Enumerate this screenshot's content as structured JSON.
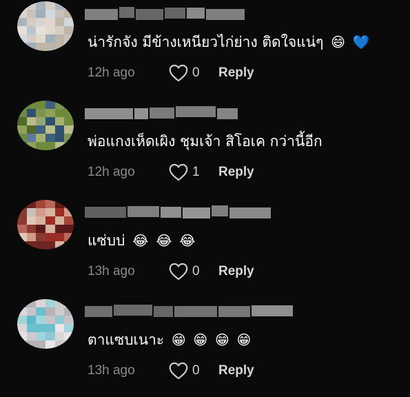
{
  "comments": [
    {
      "text": "น่ารักจัง มีข้างเหนียวไก่ย่าง ติดใจแน่ๆ",
      "emojis": [
        "😄",
        "💙"
      ],
      "time": "12h ago",
      "likes": "0",
      "reply_label": "Reply"
    },
    {
      "text": "พ่อแกงเห็ดเผิง ชุมเจ้า สิโอเค กว่านี้อีก",
      "emojis": [],
      "time": "12h ago",
      "likes": "1",
      "reply_label": "Reply"
    },
    {
      "text": "แซ่บบ่",
      "emojis": [
        "😂",
        "😂",
        "😂"
      ],
      "time": "13h ago",
      "likes": "0",
      "reply_label": "Reply"
    },
    {
      "text": "ตาแซบเนาะ",
      "emojis": [
        "😁",
        "😁",
        "😁",
        "😁"
      ],
      "time": "13h ago",
      "likes": "0",
      "reply_label": "Reply"
    }
  ],
  "icons": {
    "like": "heart-outline-icon"
  },
  "colors": {
    "background": "#0a0a0a",
    "text": "#ffffff",
    "secondary": "#8a8a8a",
    "reply": "#d8d8d8"
  }
}
